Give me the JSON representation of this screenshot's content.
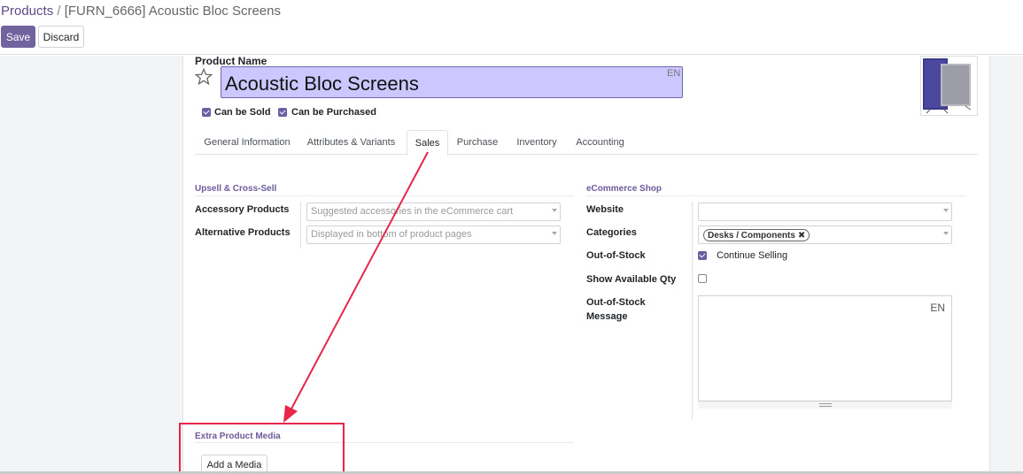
{
  "breadcrumb": {
    "parent": "Products",
    "separator": "/",
    "current": "[FURN_6666] Acoustic Bloc Screens"
  },
  "toolbar": {
    "save_label": "Save",
    "discard_label": "Discard"
  },
  "product": {
    "name_label": "Product Name",
    "name_value": "Acoustic Bloc Screens",
    "name_lang": "EN",
    "can_be_sold_label": "Can be Sold",
    "can_be_sold_checked": true,
    "can_be_purchased_label": "Can be Purchased",
    "can_be_purchased_checked": true
  },
  "tabs": [
    {
      "label": "General Information",
      "active": false
    },
    {
      "label": "Attributes & Variants",
      "active": false
    },
    {
      "label": "Sales",
      "active": true
    },
    {
      "label": "Purchase",
      "active": false
    },
    {
      "label": "Inventory",
      "active": false
    },
    {
      "label": "Accounting",
      "active": false
    }
  ],
  "upsell": {
    "title": "Upsell & Cross-Sell",
    "accessory_label": "Accessory Products",
    "accessory_placeholder": "Suggested accessories in the eCommerce cart",
    "alternative_label": "Alternative Products",
    "alternative_placeholder": "Displayed in bottom of product pages"
  },
  "ecommerce": {
    "title": "eCommerce Shop",
    "website_label": "Website",
    "website_value": "",
    "categories_label": "Categories",
    "categories_tags": [
      "Desks / Components"
    ],
    "tag_remove_symbol": "✖",
    "out_of_stock_label": "Out-of-Stock",
    "continue_selling_label": "Continue Selling",
    "continue_selling_checked": true,
    "show_qty_label": "Show Available Qty",
    "show_qty_checked": false,
    "oos_message_label_line1": "Out-of-Stock",
    "oos_message_label_line2": "Message",
    "oos_message_lang": "EN"
  },
  "media": {
    "title": "Extra Product Media",
    "add_label": "Add a Media"
  },
  "colors": {
    "brand": "#71639e",
    "annotation": "#e8264a",
    "name_highlight": "#ccc8ff"
  }
}
